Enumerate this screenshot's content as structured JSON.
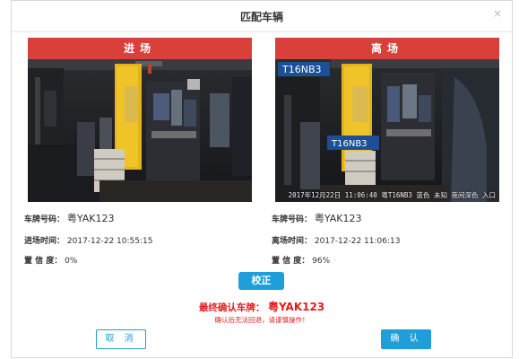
{
  "dialog": {
    "title": "匹配车辆",
    "close_glyph": "×"
  },
  "entry": {
    "header": "进场",
    "plate_label": "车牌号码：",
    "plate_value": "粤YAK123",
    "time_label": "进场时间：",
    "time_value": "2017-12-22 10:55:15",
    "conf_label": "置 信 度：",
    "conf_value": "0%"
  },
  "exit": {
    "header": "离场",
    "photo_plate_text": "T16NB3",
    "photo_caption": "2017年12月22日 11:06:40 粤T16NB3 蓝色 未知 夜间深色 入口",
    "plate_label": "车牌号码：",
    "plate_value": "粤YAK123",
    "time_label": "离场时间：",
    "time_value": "2017-12-22 11:06:13",
    "conf_label": "置 信 度：",
    "conf_value": "96%"
  },
  "actions": {
    "verify_label": "校正",
    "final_label": "最终确认车牌：",
    "final_plate": "粤YAK123",
    "warning": "确认后无法回退，请谨慎操作！",
    "cancel_label": "取 消",
    "confirm_label": "确 认"
  },
  "colors": {
    "header_red": "#d9403a",
    "accent_blue": "#1e9fda",
    "warning_red": "#e21d1d"
  },
  "icons": [
    "close-icon"
  ]
}
